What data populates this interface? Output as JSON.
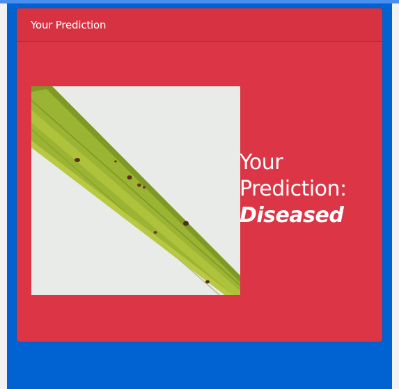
{
  "card": {
    "header_title": "Your Prediction"
  },
  "prediction": {
    "label": "Your Prediction:",
    "result": "Diseased"
  },
  "colors": {
    "card_red": "#dc3545",
    "page_blue": "#0063d1",
    "leaf_green": "#9cb433"
  }
}
